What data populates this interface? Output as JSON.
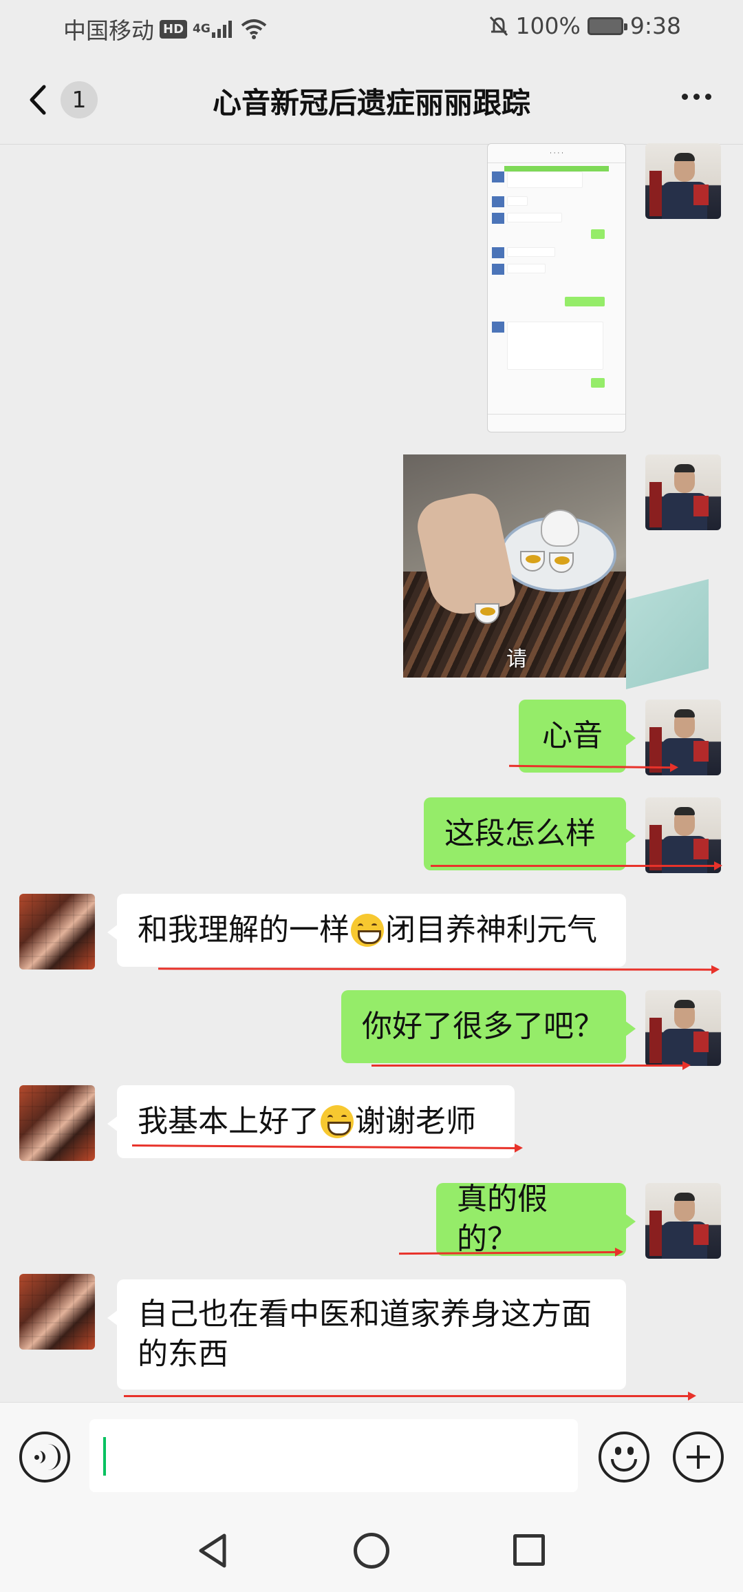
{
  "status_bar": {
    "carrier": "中国移动",
    "hd": "HD",
    "network": "4G",
    "battery": "100%",
    "time": "9:38"
  },
  "header": {
    "unread_count": "1",
    "title": "心音新冠后遗症丽丽跟踪"
  },
  "messages": [
    {
      "sender": "me",
      "type": "image",
      "image": "chat-screenshot"
    },
    {
      "sender": "me",
      "type": "image",
      "image": "tea-photo",
      "caption": "请"
    },
    {
      "sender": "me",
      "type": "text",
      "text": "心音"
    },
    {
      "sender": "me",
      "type": "text",
      "text": "这段怎么样"
    },
    {
      "sender": "her",
      "type": "text",
      "text_a": "和我理解的一样",
      "emoji": "grin",
      "text_b": "闭目养神利元气"
    },
    {
      "sender": "me",
      "type": "text",
      "text": "你好了很多了吧？"
    },
    {
      "sender": "her",
      "type": "text",
      "text_a": "我基本上好了",
      "emoji": "grin",
      "text_b": "谢谢老师"
    },
    {
      "sender": "me",
      "type": "text",
      "text": "真的假的？"
    },
    {
      "sender": "her",
      "type": "text",
      "line1": "自己也在看中医和道家养身这方面",
      "line2": "的东西"
    }
  ],
  "colors": {
    "my_bubble": "#95ec69",
    "her_bubble": "#ffffff",
    "annotation_line": "#e8322a",
    "caret": "#07c160"
  },
  "input": {
    "value": ""
  },
  "icons": [
    "back-arrow-icon",
    "more-icon",
    "voice-icon",
    "emoji-icon",
    "plus-icon",
    "nav-back-icon",
    "nav-home-icon",
    "nav-recent-icon"
  ]
}
